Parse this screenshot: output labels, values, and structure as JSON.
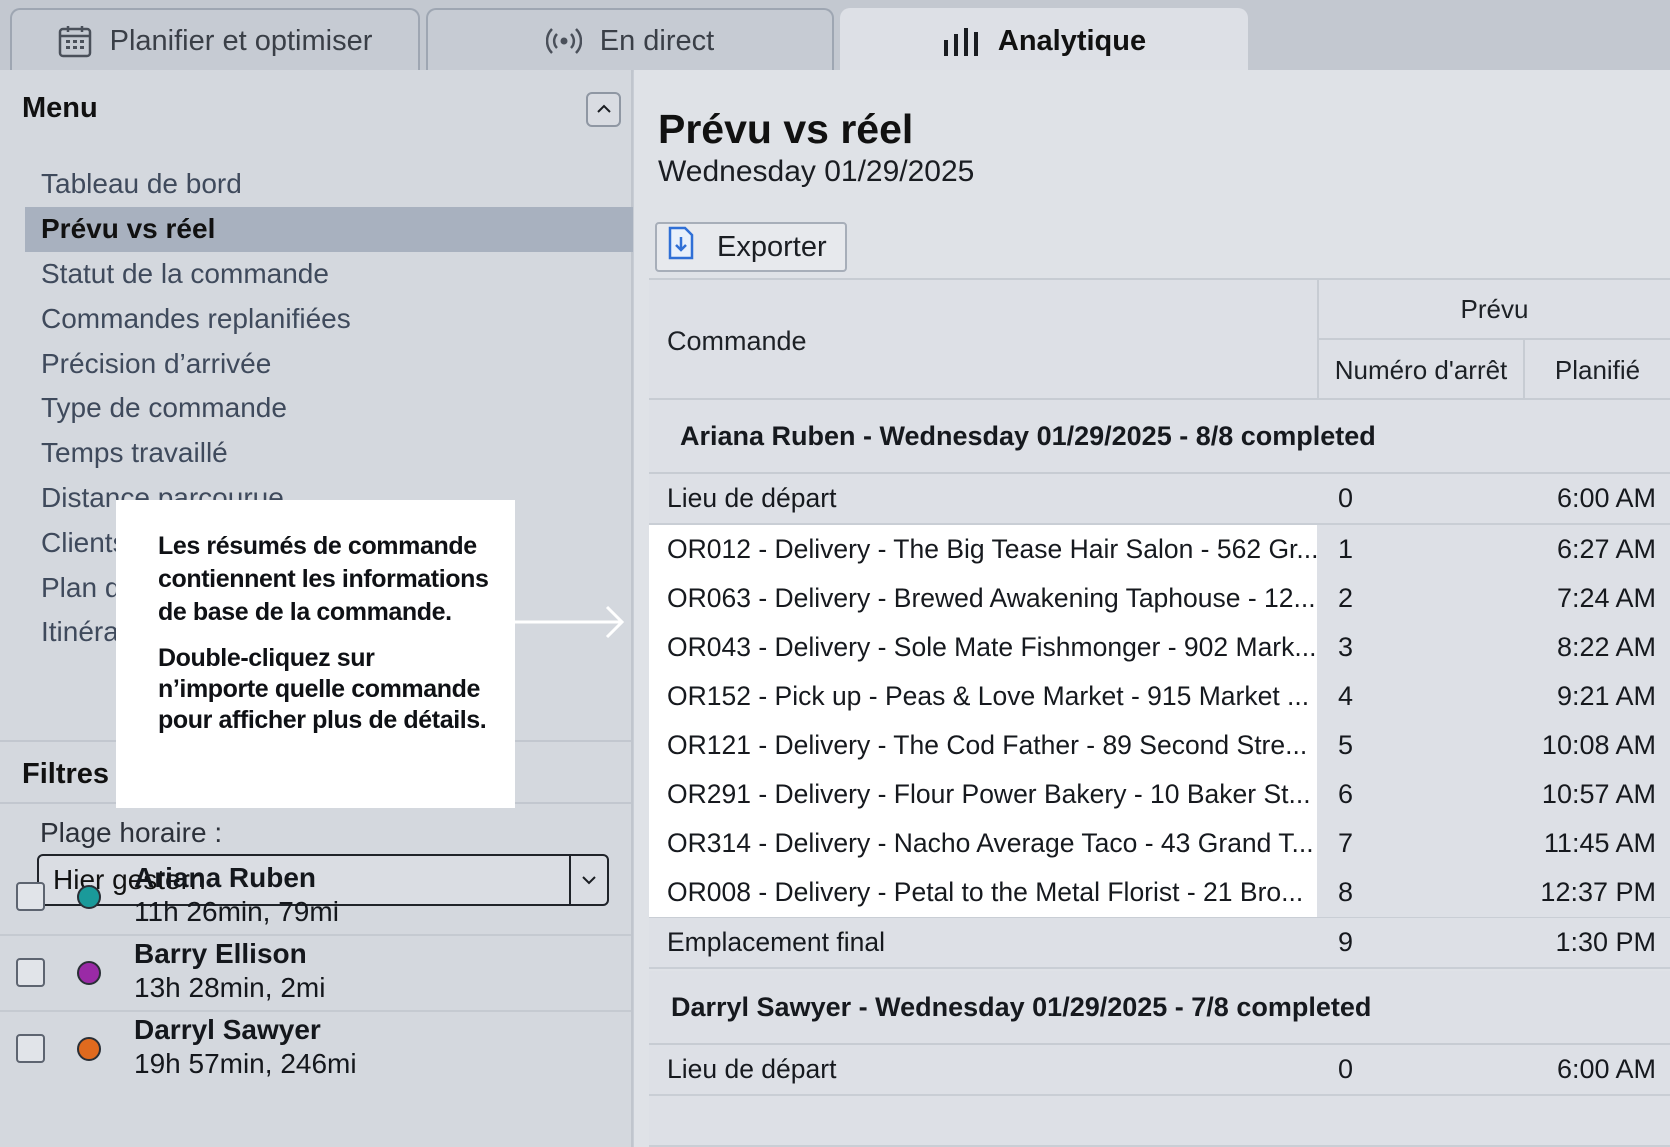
{
  "tabs": [
    {
      "label": "Planifier et optimiser",
      "icon": "calendar-icon",
      "active": false
    },
    {
      "label": "En direct",
      "icon": "live-broadcast-icon",
      "active": false
    },
    {
      "label": "Analytique",
      "icon": "bar-chart-icon",
      "active": true
    }
  ],
  "sidebar": {
    "menu_title": "Menu",
    "items": [
      {
        "label": "Tableau de bord"
      },
      {
        "label": "Prévu vs réel",
        "active": true
      },
      {
        "label": "Statut de la commande"
      },
      {
        "label": "Commandes replanifiées"
      },
      {
        "label": "Précision d’arrivée"
      },
      {
        "label": "Type de commande"
      },
      {
        "label": "Temps travaillé"
      },
      {
        "label": "Distance parcourue"
      },
      {
        "label": "Clients"
      },
      {
        "label": "Plan de"
      },
      {
        "label": "Itinérai"
      }
    ],
    "filters_title": "Filtres",
    "range_label": "Plage horaire :",
    "range_value": "Hier gestern",
    "drivers": [
      {
        "name": "Ariana Ruben",
        "stats": "11h 26min, 79mi",
        "color": "#1a9a9a"
      },
      {
        "name": "Barry Ellison",
        "stats": "13h 28min, 2mi",
        "color": "#9a2aa6"
      },
      {
        "name": "Darryl Sawyer",
        "stats": "19h 57min, 246mi",
        "color": "#e06a1e"
      }
    ]
  },
  "main": {
    "title": "Prévu vs réel",
    "date": "Wednesday 01/29/2025",
    "export_label": "Exporter",
    "table": {
      "col_order": "Commande",
      "col_group_planned": "Prévu",
      "col_stop": "Numéro d'arrêt",
      "col_planned": "Planifié",
      "groups": [
        {
          "header": "Ariana Ruben - Wednesday 01/29/2025 - 8/8 completed",
          "rows": [
            {
              "order": "Lieu de départ",
              "stop": "0",
              "time": "6:00 AM"
            },
            {
              "order": "OR012 - Delivery - The Big Tease Hair Salon - 562 Gr...",
              "stop": "1",
              "time": "6:27 AM"
            },
            {
              "order": "OR063 - Delivery - Brewed Awakening Taphouse - 12...",
              "stop": "2",
              "time": "7:24 AM"
            },
            {
              "order": "OR043 - Delivery - Sole Mate Fishmonger - 902 Mark...",
              "stop": "3",
              "time": "8:22 AM"
            },
            {
              "order": "OR152 - Pick up - Peas & Love Market - 915 Market ...",
              "stop": "4",
              "time": "9:21 AM"
            },
            {
              "order": "OR121 - Delivery - The Cod Father - 89 Second Stre...",
              "stop": "5",
              "time": "10:08 AM"
            },
            {
              "order": "OR291 - Delivery - Flour Power Bakery - 10 Baker St...",
              "stop": "6",
              "time": "10:57 AM"
            },
            {
              "order": "OR314 - Delivery - Nacho Average Taco - 43 Grand T...",
              "stop": "7",
              "time": "11:45 AM"
            },
            {
              "order": "OR008 - Delivery - Petal to the Metal Florist - 21 Bro...",
              "stop": "8",
              "time": "12:37 PM"
            },
            {
              "order": "Emplacement final",
              "stop": "9",
              "time": "1:30 PM"
            }
          ]
        },
        {
          "header": "Darryl Sawyer - Wednesday 01/29/2025 - 7/8 completed",
          "rows": [
            {
              "order": "Lieu de départ",
              "stop": "0",
              "time": "6:00 AM"
            }
          ]
        }
      ]
    }
  },
  "tooltip": {
    "text1": "Les résumés de commande contiennent les informations de base de la commande.",
    "text2": "Double-cliquez sur n’importe quelle commande pour afficher plus de détails."
  }
}
